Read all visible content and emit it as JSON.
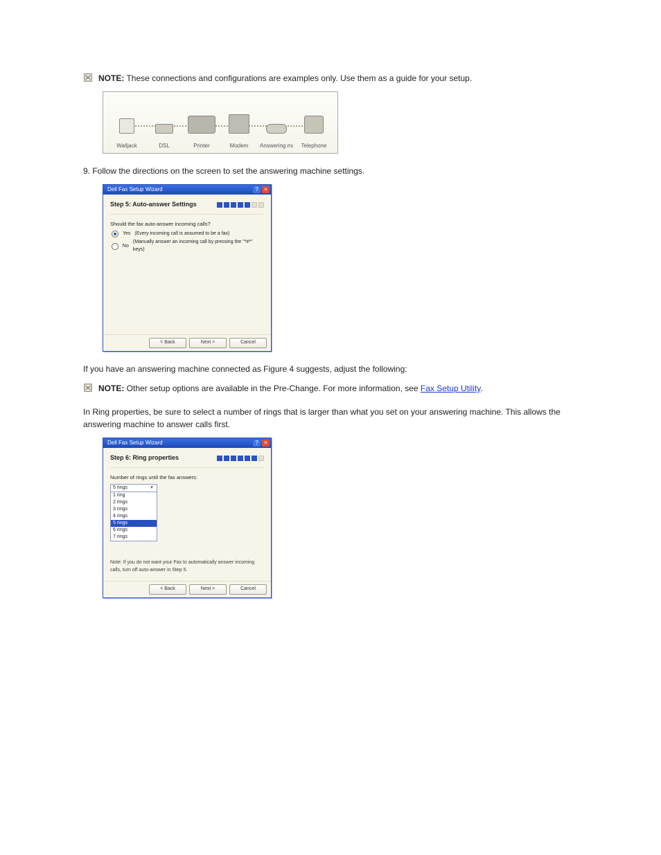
{
  "notes": {
    "n1_prefix": "NOTE:",
    "n1_text": " These connections and configurations are examples only. Use them as a guide for your setup.",
    "n2_prefix": "NOTE:",
    "n2_text_a": " Other setup options are available in the ",
    "n2_text_b": "Pre-Change",
    "n2_link": "Fax Setup Utility",
    "n2_text_c": ". For more information, see ",
    "n2_text_d": "."
  },
  "diagram": {
    "labels": [
      "Walljack",
      "DSL",
      "Printer",
      "Modem",
      "Answering mac...",
      "Telephone"
    ]
  },
  "step5_intro": "9. Follow the directions on the screen to set the answering machine settings.",
  "step5_instruct": "If you have an answering machine connected as Figure 4 suggests, adjust the following:",
  "wizard": {
    "titlebar": "Dell Fax Setup Wizard",
    "title5": "Step 5: Auto-answer Settings",
    "q5": "Should the fax auto-answer incoming calls?",
    "yes_label": "Yes",
    "yes_hint": "(Every incoming call is assumed to be a fax)",
    "no_label": "No",
    "no_hint": "(Manually answer an incoming call by pressing the \"*#*\" keys)",
    "title6": "Step 6: Ring properties",
    "q6": "Number of rings until the fax answers:",
    "combo_value": "5 rings",
    "options": [
      "1 ring",
      "2 rings",
      "3 rings",
      "4 rings",
      "5 rings",
      "6 rings",
      "7 rings"
    ],
    "note6": "Note: If you do not want your Fax to automatically answer incoming calls, turn off auto-answer in Step 5.",
    "back": "< Back",
    "next": "Next >",
    "cancel": "Cancel"
  },
  "between56": "In Ring properties, be sure to select a number of rings that is larger than what you set on your answering machine. This allows the answering machine to answer calls first."
}
